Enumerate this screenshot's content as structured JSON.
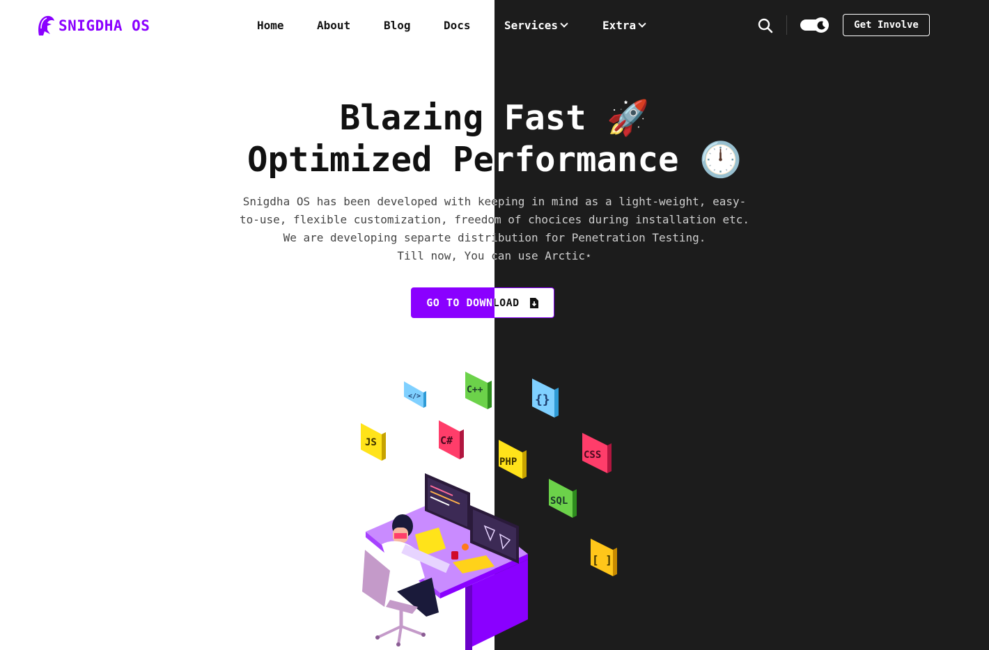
{
  "brand": {
    "name": "SNIGDHA OS",
    "accent": "#8a00ff"
  },
  "nav": {
    "items": [
      {
        "label": "Home",
        "dropdown": false
      },
      {
        "label": "About",
        "dropdown": false
      },
      {
        "label": "Blog",
        "dropdown": false
      },
      {
        "label": "Docs",
        "dropdown": false
      },
      {
        "label": "Services",
        "dropdown": true
      },
      {
        "label": "Extra",
        "dropdown": true
      }
    ],
    "search_icon": "search-icon",
    "theme_toggle_icon": "moon-toggle-icon",
    "cta_label": "Get Involve"
  },
  "hero": {
    "title_line1": "Blazing Fast",
    "title_line1_emoji": "🚀",
    "title_line2": "Optimized Performance",
    "title_line2_emoji": "🕛",
    "description": [
      "Snigdha OS has been developed with keeping in mind as a light-weight, easy-",
      "to-use, flexible customization, freedom of chocices during installation etc.",
      "We are developing separte distribution for Penetration Testing.",
      "Till now, You can use Arctic⋆"
    ],
    "download_label": "GO TO DOWNLOAD",
    "download_icon": "file-download-icon"
  },
  "illustration": {
    "tiles": [
      "</>",
      "C++",
      "{}",
      "JS",
      "C#",
      "PHP",
      "CSS",
      "SQL",
      "[ ]"
    ]
  },
  "colors": {
    "light_bg": "#ffffff",
    "dark_bg": "#1c1c1c"
  }
}
